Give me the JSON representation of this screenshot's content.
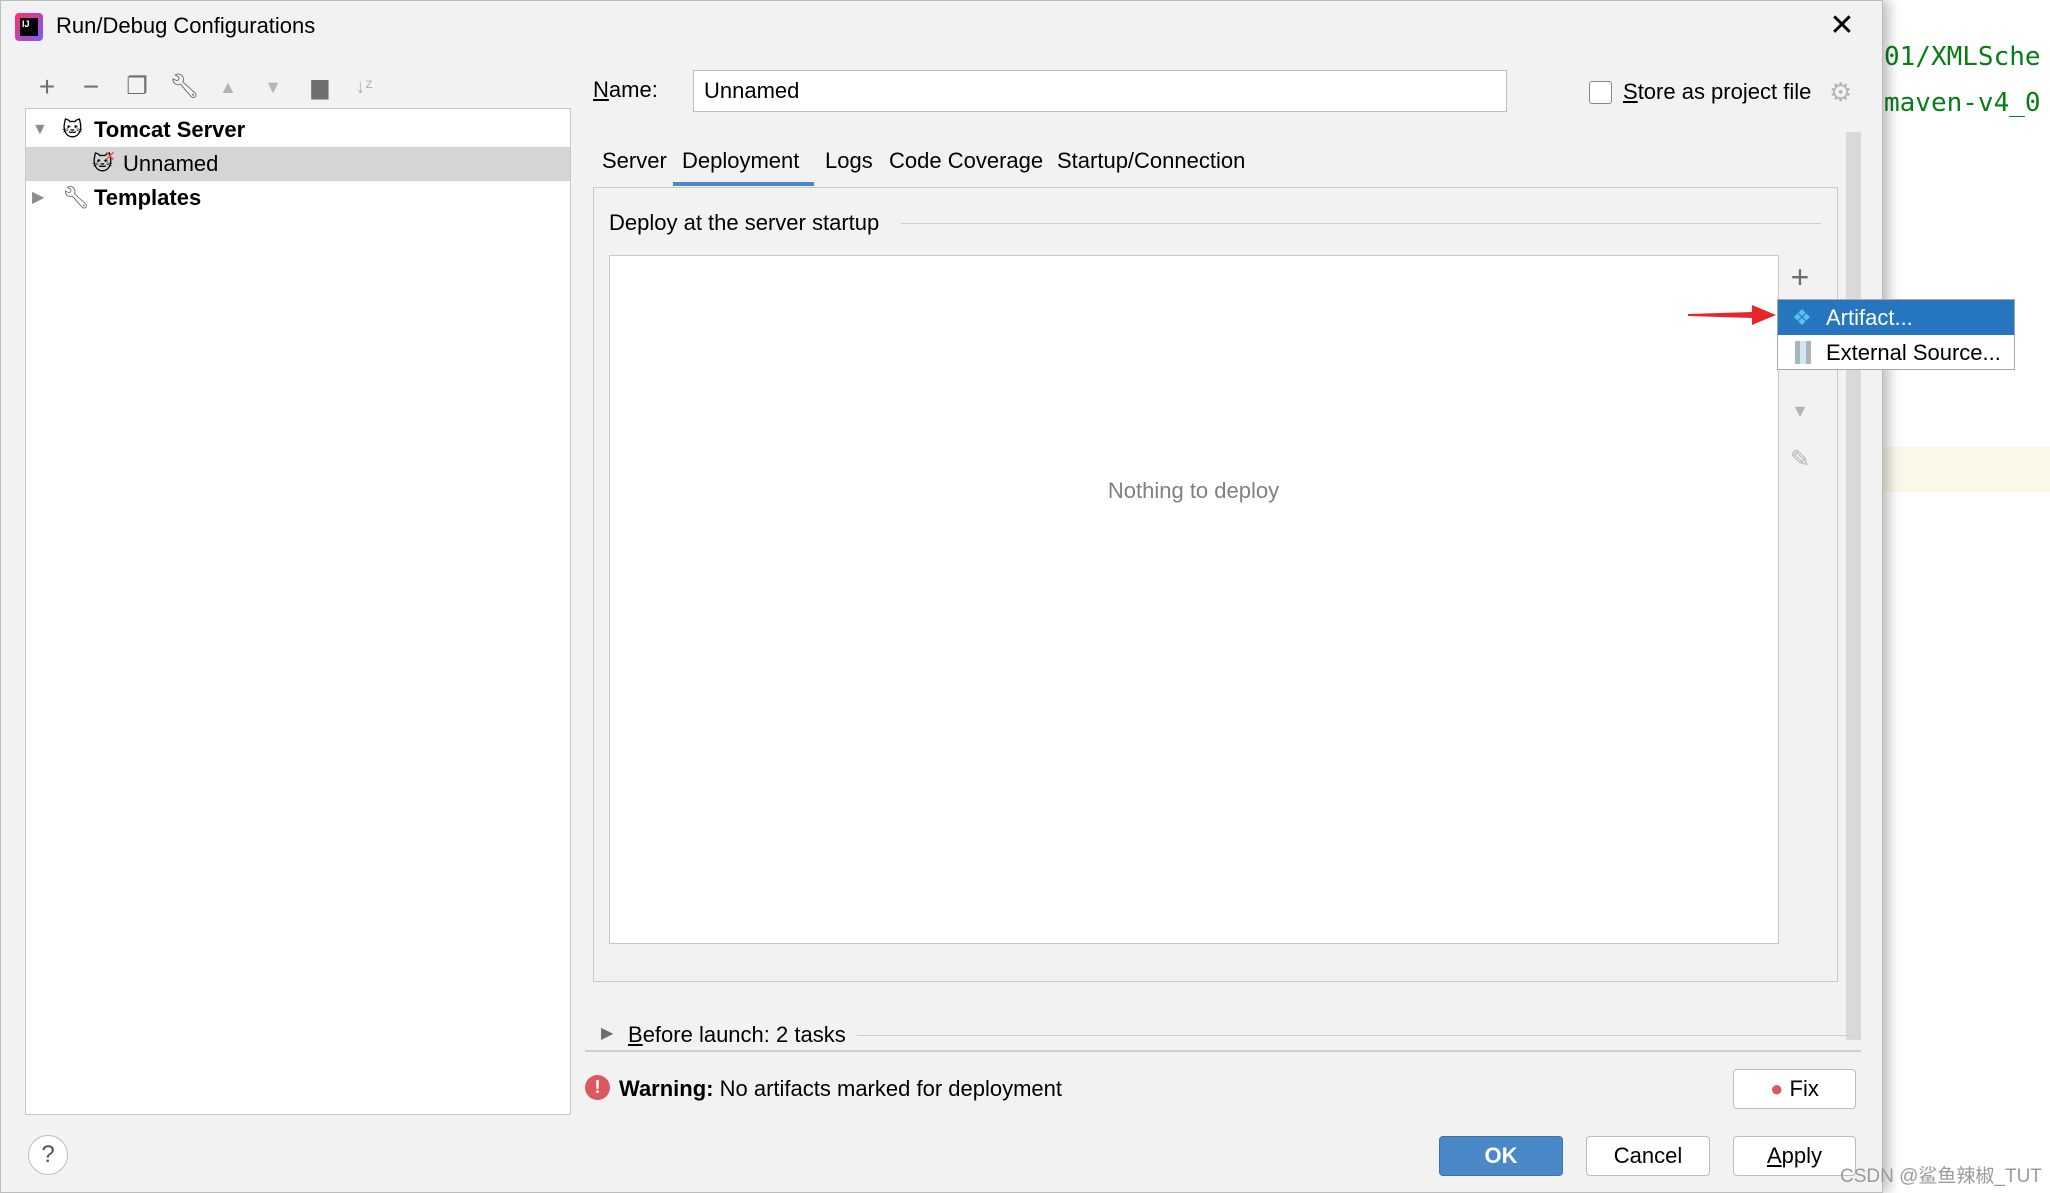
{
  "editor_background": {
    "lines": [
      "01/XMLSche",
      "maven-v4_0"
    ]
  },
  "dialog": {
    "title": "Run/Debug Configurations",
    "toolbar": {
      "icons": [
        "add-icon",
        "remove-icon",
        "copy-icon",
        "wrench-icon",
        "move-up-icon",
        "move-down-icon",
        "new-folder-icon",
        "sort-alpha-icon"
      ]
    },
    "tree": {
      "items": [
        {
          "label": "Tomcat Server",
          "expanded": true,
          "bold": true
        },
        {
          "label": "Unnamed",
          "selected": true
        },
        {
          "label": "Templates",
          "expanded": false,
          "bold": true
        }
      ]
    },
    "name_label_u": "N",
    "name_label_rest": "ame:",
    "name_value": "Unnamed",
    "store_u": "S",
    "store_rest": "tore as project file",
    "store_checked": false,
    "tabs": [
      {
        "label": "Server"
      },
      {
        "label": "Deployment",
        "active": true
      },
      {
        "label": "Logs"
      },
      {
        "label": "Code Coverage"
      },
      {
        "label": "Startup/Connection"
      }
    ],
    "deploy_section": "Deploy at the server startup",
    "empty_text": "Nothing to deploy",
    "popup": {
      "items": [
        {
          "label": "Artifact...",
          "selected": true
        },
        {
          "label": "External Source..."
        }
      ]
    },
    "before_launch_u": "B",
    "before_launch_rest": "efore launch: 2 tasks",
    "warning_label": "Warning:",
    "warning_text": "No artifacts marked for deployment",
    "fix_label": "Fix",
    "ok_label": "OK",
    "cancel_label": "Cancel",
    "apply_u": "A",
    "apply_rest": "pply",
    "help_label": "?"
  },
  "watermark": "CSDN @鲨鱼辣椒_TUT",
  "colors": {
    "accent": "#2675bf",
    "ok_button": "#4a88c7",
    "warning": "#db5860",
    "arrow": "#e8262a"
  }
}
